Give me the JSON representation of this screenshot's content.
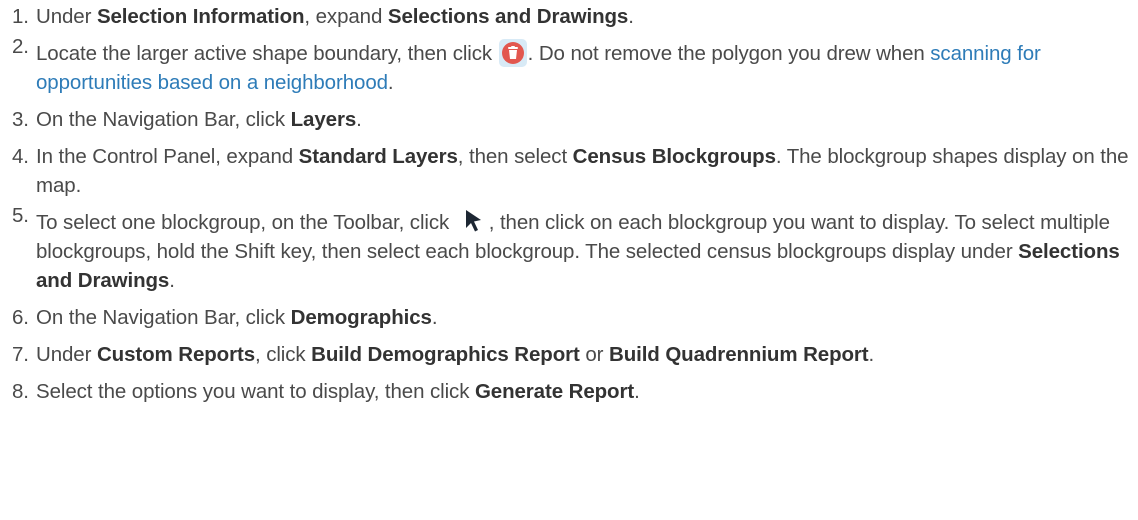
{
  "steps": [
    {
      "number": "1.",
      "t1": "Under ",
      "b1": "Selection Information",
      "t2": ", expand ",
      "b2": "Selections and Drawings",
      "t3": "."
    },
    {
      "number": "2.",
      "t1": "Locate the larger active shape boundary, then click ",
      "t2": ". Do not remove the polygon you drew when ",
      "link": "scanning for opportunities based on a neighborhood",
      "t3": ".",
      "icon": "delete-icon"
    },
    {
      "number": "3.",
      "t1": "On the Navigation Bar, click ",
      "b1": "Layers",
      "t2": "."
    },
    {
      "number": "4.",
      "t1": "In the Control Panel, expand ",
      "b1": "Standard Layers",
      "t2": ", then select ",
      "b2": "Census Blockgroups",
      "t3": ". The blockgroup shapes display on the map."
    },
    {
      "number": "5.",
      "t1": "To select one blockgroup, on the Toolbar, click ",
      "t2": ", then click on each blockgroup you want to display. To select multiple blockgroups, hold the Shift key, then select each blockgroup. The selected census blockgroups display under ",
      "b1": "Selections and Drawings",
      "t3": ".",
      "icon": "pointer-icon"
    },
    {
      "number": "6.",
      "t1": "On the Navigation Bar, click ",
      "b1": "Demographics",
      "t2": "."
    },
    {
      "number": "7.",
      "t1": "Under ",
      "b1": "Custom Reports",
      "t2": ", click ",
      "b2": "Build Demographics Report",
      "t3": " or ",
      "b3": "Build Quadrennium Report",
      "t4": "."
    },
    {
      "number": "8.",
      "t1": "Select the options you want to display, then click ",
      "b1": "Generate Report",
      "t2": "."
    }
  ],
  "colors": {
    "text": "#4a4a4a",
    "link": "#2e7cb8",
    "delete_button_bg": "#d8eaf6",
    "delete_icon": "#e2574f"
  }
}
